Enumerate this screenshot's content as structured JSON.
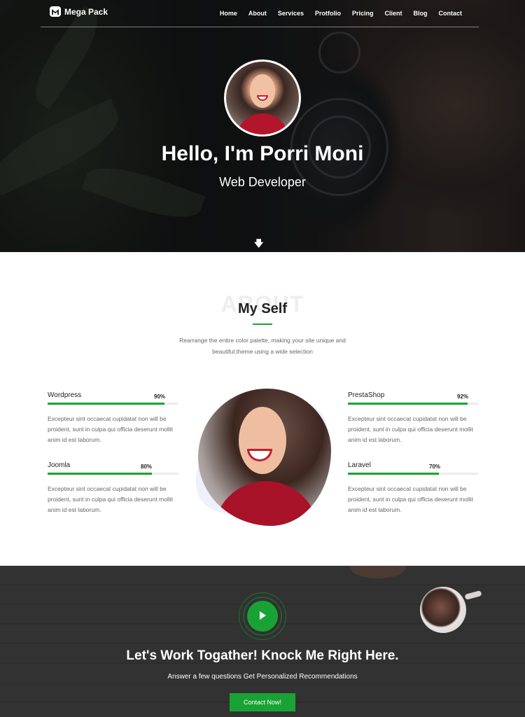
{
  "nav": {
    "brand": "Mega Pack",
    "items": [
      "Home",
      "About",
      "Services",
      "Protfolio",
      "Pricing",
      "Client",
      "Blog",
      "Contact"
    ]
  },
  "hero": {
    "title": "Hello, I'm Porri Moni",
    "subtitle": "Web Developer"
  },
  "about": {
    "ghost_text": "ABOUT",
    "title": "My Self",
    "description": "Rearrange the entire color palette, making your site unique and beautiful.theme using a wide selection",
    "skills": [
      {
        "name": "Wordpress",
        "percent_label": "90%",
        "percent": 90,
        "text": "Excepteur sint occaecat cupidatat non will be proident, sunt in culpa qui officia deserunt mollit anim id est laborum."
      },
      {
        "name": "Joomla",
        "percent_label": "80%",
        "percent": 80,
        "text": "Excepteur sint occaecat cupidatat non will be proident, sunt in culpa qui officia deserunt mollit anim id est laborum."
      },
      {
        "name": "PrestaShop",
        "percent_label": "92%",
        "percent": 92,
        "text": "Excepteur sint occaecat cupidatat non will be proident, sunt in culpa qui officia deserunt mollit anim id est laborum."
      },
      {
        "name": "Laravel",
        "percent_label": "70%",
        "percent": 70,
        "text": "Excepteur sint occaecat cupidatat non will be proident, sunt in culpa qui officia deserunt mollit anim id est laborum."
      }
    ]
  },
  "cta": {
    "title": "Let's Work Togather! Knock Me Right Here.",
    "subtitle": "Answer a few questions Get Personalized Recommendations",
    "button": "Contact Now!"
  },
  "colors": {
    "accent": "#1aa335",
    "ghost": "#eeeeee",
    "blob": "#eef0fb"
  },
  "icons": {
    "logo": "mega-pack-logo-icon",
    "scroll": "arrow-down-icon",
    "play": "play-icon"
  }
}
